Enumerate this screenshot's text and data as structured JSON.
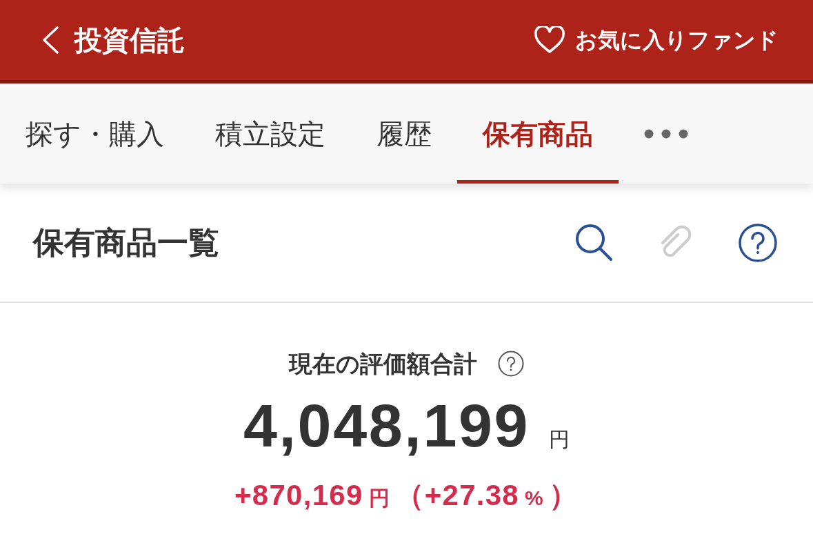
{
  "header": {
    "title": "投資信託",
    "favorites_link": "お気に入りファンド"
  },
  "tabs": [
    {
      "label": "探す・購入",
      "selected": false
    },
    {
      "label": "積立設定",
      "selected": false
    },
    {
      "label": "履歴",
      "selected": false
    },
    {
      "label": "保有商品",
      "selected": true
    }
  ],
  "holdings": {
    "title": "保有商品一覧",
    "toolbar": [
      {
        "kind": "search",
        "disabled": false
      },
      {
        "kind": "attachment",
        "disabled": true
      },
      {
        "kind": "help",
        "disabled": false
      }
    ]
  },
  "summary": {
    "label": "現在の評価額合計",
    "total": "4,048,199",
    "total_unit": "円",
    "gain_parts": [
      {
        "kind": "value",
        "text": "+870,169"
      },
      {
        "kind": "unit",
        "text": "円"
      },
      {
        "kind": "value",
        "text": "（+27.38"
      },
      {
        "kind": "unit",
        "text": "%"
      },
      {
        "kind": "value",
        "text": "）"
      }
    ]
  }
}
